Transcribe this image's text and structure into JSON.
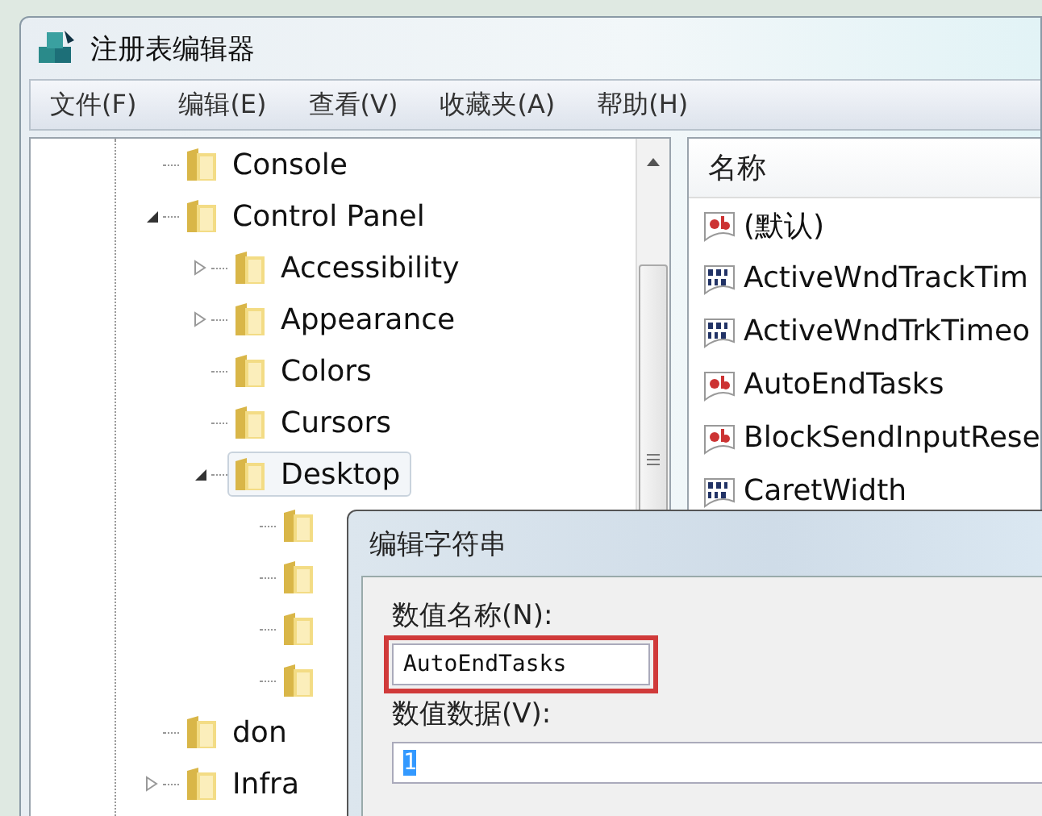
{
  "window": {
    "title": "注册表编辑器"
  },
  "menu": [
    "文件(F)",
    "编辑(E)",
    "查看(V)",
    "收藏夹(A)",
    "帮助(H)"
  ],
  "tree": [
    {
      "kind": "leaf",
      "label": "Console",
      "selected": false
    },
    {
      "kind": "node",
      "label": "Control Panel",
      "expanded": true,
      "selected": false,
      "children": [
        {
          "kind": "node",
          "label": "Accessibility",
          "expanded": false,
          "selected": false
        },
        {
          "kind": "node",
          "label": "Appearance",
          "expanded": false,
          "selected": false
        },
        {
          "kind": "leaf",
          "label": "Colors",
          "selected": false
        },
        {
          "kind": "leaf",
          "label": "Cursors",
          "selected": false
        },
        {
          "kind": "node",
          "label": "Desktop",
          "expanded": true,
          "selected": true,
          "children": [
            {
              "kind": "leaf",
              "selected": false
            },
            {
              "kind": "leaf",
              "selected": false
            },
            {
              "kind": "leaf",
              "selected": false
            },
            {
              "kind": "leaf",
              "selected": false
            }
          ]
        }
      ]
    },
    {
      "kind": "leaf",
      "label": "don",
      "selected": false
    },
    {
      "kind": "node",
      "label": "Infra",
      "expanded": false,
      "selected": false
    }
  ],
  "values": {
    "column": "名称",
    "rows": [
      {
        "kind": "string",
        "name": "(默认)"
      },
      {
        "kind": "binary",
        "name": "ActiveWndTrackTim"
      },
      {
        "kind": "binary",
        "name": "ActiveWndTrkTimeo"
      },
      {
        "kind": "string",
        "name": "AutoEndTasks"
      },
      {
        "kind": "string",
        "name": "BlockSendInputRese"
      },
      {
        "kind": "binary",
        "name": "CaretWidth"
      }
    ]
  },
  "dialog": {
    "title": "编辑字符串",
    "name_label": "数值名称(N):",
    "name_value": "AutoEndTasks",
    "name_highlighted": true,
    "data_label": "数值数据(V):",
    "data_value": "1",
    "data_selected": true
  }
}
